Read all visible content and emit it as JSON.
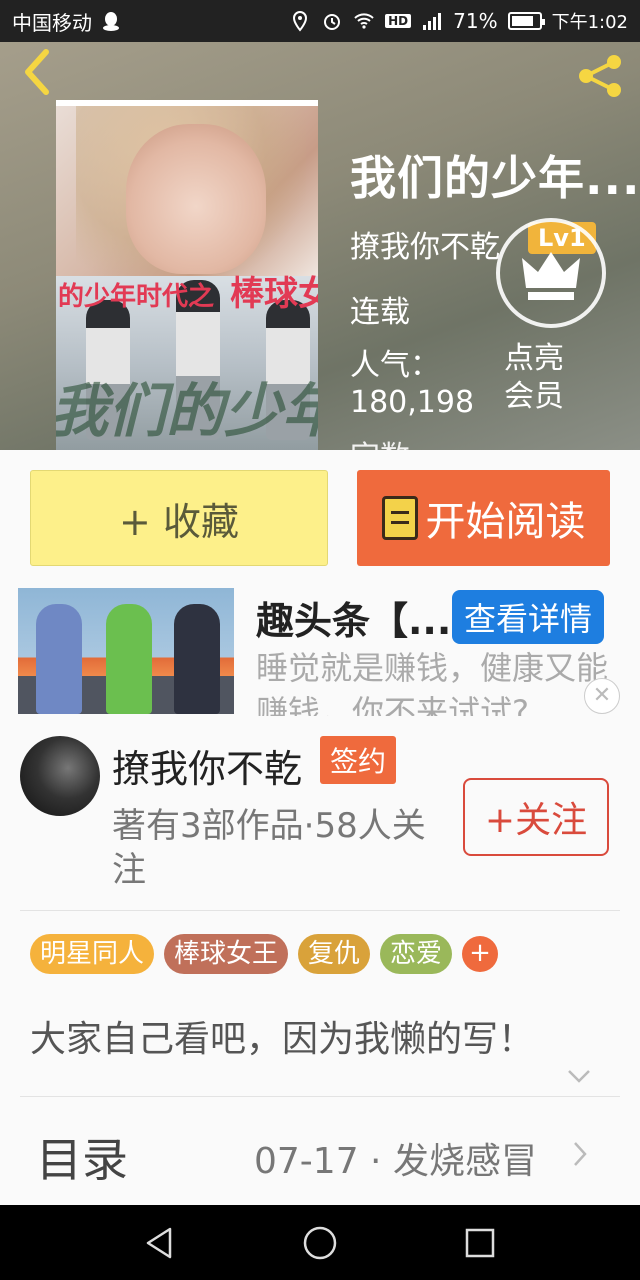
{
  "status_bar": {
    "carrier": "中国移动",
    "network": "4G",
    "battery_pct": "71%",
    "battery_level": 0.71,
    "time": "下午1:02",
    "hd_badge": "HD"
  },
  "book": {
    "title": "我们的少年...",
    "author_with_level": "撩我你不乾",
    "level_badge": "Lv1",
    "status": "连载",
    "popularity_label": "人气：",
    "popularity_value": "180,198",
    "words_label_cut": "字数",
    "vip_line1": "点亮",
    "vip_line2": "会员",
    "cover_title": "的少年时代之",
    "cover_title_big": "棒球女",
    "cover_graffiti": "我们的少年时代"
  },
  "actions": {
    "collect_label": "+ 收藏",
    "read_label": "开始阅读"
  },
  "ad": {
    "title": "趣头条【...",
    "detail_label": "查看详情",
    "description": "睡觉就是赚钱，健康又能赚钱，你不来试试?",
    "close_icon": "close-icon"
  },
  "author": {
    "name": "撩我你不乾",
    "sign_badge": "签约",
    "meta": "著有3部作品·58人关注",
    "follow_label": "+关注"
  },
  "tags": [
    {
      "label": "明星同人",
      "color": "#f5b23c"
    },
    {
      "label": "棒球女王",
      "color": "#c0705a"
    },
    {
      "label": "复仇",
      "color": "#d9a23a"
    },
    {
      "label": "恋爱",
      "color": "#9ab85a"
    }
  ],
  "tag_add_label": "+",
  "synopsis": "大家自己看吧，因为我懒的写！",
  "toc": {
    "label": "目录",
    "latest": "07-17 · 发烧感冒"
  },
  "colors": {
    "accent": "#ef6a3d",
    "collect_bg": "#fdf08a",
    "detail_blue": "#1e7ee0",
    "level_gold": "#f1b43b"
  }
}
